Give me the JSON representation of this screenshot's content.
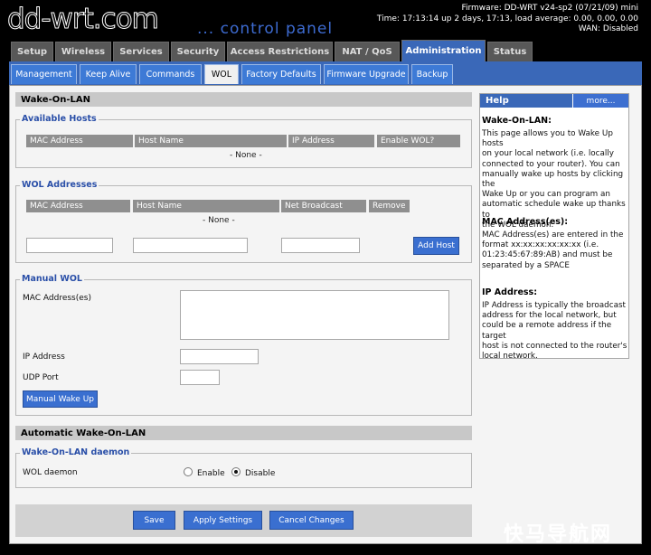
{
  "header": {
    "logo": "dd-wrt.com",
    "subtitle": "... control panel",
    "firmware": "Firmware: DD-WRT v24-sp2 (07/21/09) mini",
    "time": "Time: 17:13:14 up 2 days, 17:13, load average: 0.00, 0.00, 0.00",
    "wan": "WAN: Disabled"
  },
  "main_tabs": [
    "Setup",
    "Wireless",
    "Services",
    "Security",
    "Access Restrictions",
    "NAT / QoS",
    "Administration",
    "Status"
  ],
  "sub_tabs": [
    "Management",
    "Keep Alive",
    "Commands",
    "WOL",
    "Factory Defaults",
    "Firmware Upgrade",
    "Backup"
  ],
  "wol": {
    "title": "Wake-On-LAN",
    "available_hosts": {
      "legend": "Available Hosts",
      "columns": [
        "MAC Address",
        "Host Name",
        "IP Address",
        "Enable WOL?"
      ],
      "empty": "- None -"
    },
    "wol_addresses": {
      "legend": "WOL Addresses",
      "columns": [
        "MAC Address",
        "Host Name",
        "Net Broadcast",
        "Remove"
      ],
      "empty": "- None -",
      "add_button": "Add Host"
    },
    "manual": {
      "legend": "Manual WOL",
      "mac_label": "MAC Address(es)",
      "ip_label": "IP Address",
      "udp_label": "UDP Port",
      "button": "Manual Wake Up"
    }
  },
  "auto": {
    "title": "Automatic Wake-On-LAN",
    "legend": "Wake-On-LAN daemon",
    "label": "WOL daemon",
    "enable": "Enable",
    "disable": "Disable",
    "selected": "Disable"
  },
  "actions": {
    "save": "Save",
    "apply": "Apply Settings",
    "cancel": "Cancel Changes"
  },
  "help": {
    "title": "Help",
    "more": "more...",
    "sections": [
      {
        "title": "Wake-On-LAN:",
        "lines": [
          "This page allows you to Wake Up hosts",
          "on your local network (i.e. locally",
          "connected to your router). You can",
          "manually wake up hosts by clicking the",
          "Wake Up or you can program an",
          "automatic schedule wake up thanks to",
          "the WOL daemon."
        ]
      },
      {
        "title": "MAC Address(es):",
        "lines": [
          "MAC Address(es) are entered in the",
          "format xx:xx:xx:xx:xx:xx (i.e.",
          "01:23:45:67:89:AB) and must be",
          "separated by a SPACE"
        ]
      },
      {
        "title": "IP Address:",
        "lines": [
          "IP Address is typically the broadcast",
          "address for the local network, but",
          "could be a remote address if the target",
          "host is not connected to the router's",
          "local network."
        ]
      }
    ]
  },
  "watermark": "快马导航网"
}
